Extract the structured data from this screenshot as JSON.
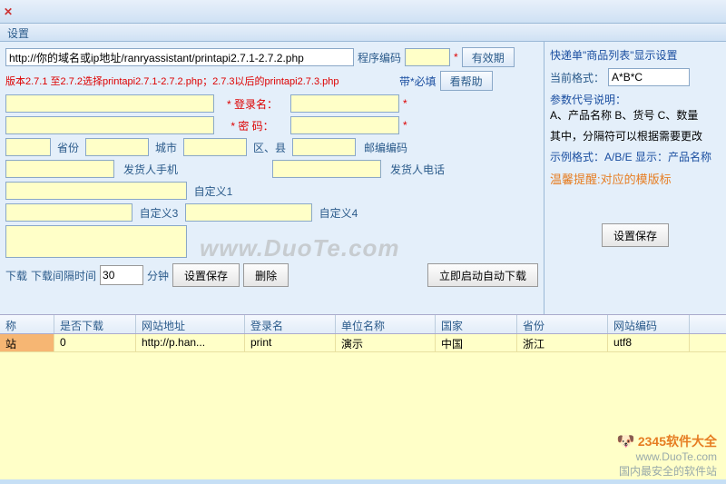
{
  "section_title": "设置",
  "url_row": {
    "url": "http://你的域名或ip地址/ranryassistant/printapi2.7.1-2.7.2.php",
    "encoding_label": "程序编码",
    "validity_btn": "有效期"
  },
  "hint_row": {
    "hint": "版本2.7.1 至2.7.2选择printapi2.7.1-2.7.2.php；2.7.3以后的printapi2.7.3.php",
    "req_label": "带*必填",
    "help_btn": "看帮助"
  },
  "login": {
    "label": "* 登录名："
  },
  "pwd": {
    "label": "* 密  码："
  },
  "addr": {
    "prov": "省份",
    "city": "城市",
    "district": "区、县",
    "postcode": "邮编编码"
  },
  "sender": {
    "mobile": "发货人手机",
    "phone": "发货人电话"
  },
  "custom": {
    "c1": "自定义1",
    "c3": "自定义3",
    "c4": "自定义4"
  },
  "bottom": {
    "dl_label": "下载",
    "interval_label": "下载间隔时间",
    "interval_value": "30",
    "unit": "分钟",
    "save_btn": "设置保存",
    "del_btn": "删除",
    "auto_btn": "立即启动自动下载"
  },
  "right": {
    "title": "快递单\"商品列表\"显示设置",
    "fmt_label": "当前格式：",
    "fmt_value": "A*B*C",
    "param_title": "参数代号说明：",
    "param_desc": "A、产品名称 B、货号  C、数量",
    "sep_desc": "其中，分隔符可以根据需要更改",
    "example": "示例格式：A/B/E  显示：产品名称",
    "warn": "温馨提醒:对应的模版标",
    "save_btn": "设置保存"
  },
  "grid": {
    "cols": [
      "称",
      "是否下载",
      "网站地址",
      "登录名",
      "单位名称",
      "国家",
      "省份",
      "网站编码"
    ],
    "row": [
      "站",
      "0",
      "http://p.han...",
      "print",
      "演示",
      "中国",
      "浙江",
      "utf8"
    ]
  },
  "footer": {
    "brand": "2345软件大全",
    "url": "www.DuoTe.com",
    "slogan": "国内最安全的软件站"
  },
  "watermark": "www.DuoTe.com"
}
